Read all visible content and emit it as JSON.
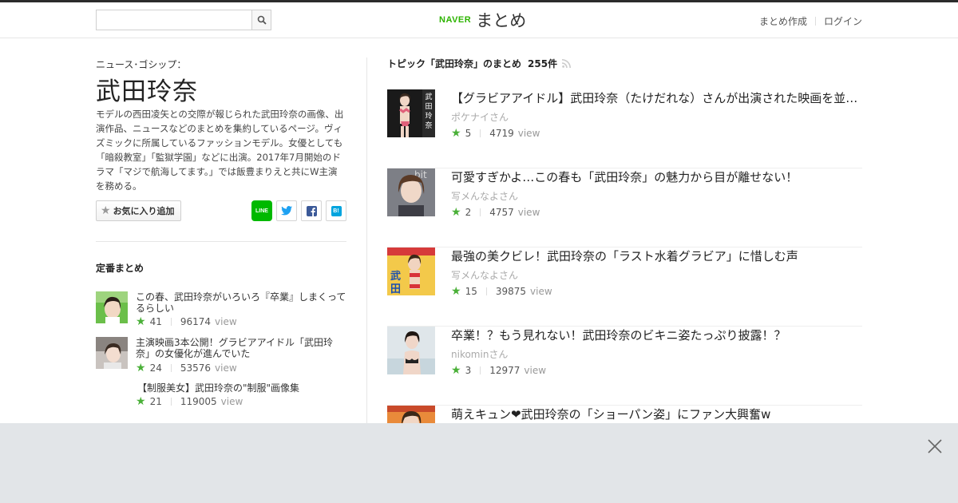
{
  "header": {
    "search": {
      "placeholder": "",
      "value": ""
    },
    "logo": {
      "brand": "NAVER",
      "name": "まとめ"
    },
    "links": [
      {
        "label": "まとめ作成"
      },
      {
        "label": "ログイン"
      }
    ]
  },
  "topic": {
    "category": "ニュース･ゴシップ：",
    "title": "武田玲奈",
    "description": "モデルの西田凌矢との交際が報じられた武田玲奈の画像、出演作品、ニュースなどのまとめを集約しているページ。ヴィズミックに所属しているファッションモデル。女優としても「暗殺教室」「監獄学園」などに出演。2017年7月開始のドラマ「マジで航海してます。」では飯豊まりえと共にW主演を務める。",
    "favorite_label": "お気に入り追加",
    "share": {
      "line": "LINE",
      "twitter": "twitter-icon",
      "facebook": "facebook-icon",
      "hatena": "B!"
    }
  },
  "teiban": {
    "title": "定番まとめ",
    "items": [
      {
        "title": "この春、武田玲奈がいろいろ『卒業』しまくってるらしい",
        "likes": "41",
        "views": "96174",
        "view_label": "view",
        "has_thumb": true
      },
      {
        "title": "主演映画3本公開！グラビアアイドル「武田玲奈」の女優化が進んでいた",
        "likes": "24",
        "views": "53576",
        "view_label": "view",
        "has_thumb": true
      },
      {
        "title": "【制服美女】武田玲奈の\"制服\"画像集",
        "likes": "21",
        "views": "119005",
        "view_label": "view",
        "has_thumb": false
      }
    ]
  },
  "topic_list": {
    "heading": "トピック「武田玲奈」のまとめ",
    "count": "255件",
    "items": [
      {
        "title": "【グラビアアイドル】武田玲奈（たけだれな）さんが出演された映画を並べてみました",
        "author": "ポケナイさん",
        "likes": "5",
        "views": "4719",
        "view_label": "view"
      },
      {
        "title": "可愛すぎかよ…この春も「武田玲奈」の魅力から目が離せない！",
        "author": "写メんなよさん",
        "likes": "2",
        "views": "4757",
        "view_label": "view"
      },
      {
        "title": "最強の美クビレ！武田玲奈の「ラスト水着グラビア」に惜しむ声",
        "author": "写メんなよさん",
        "likes": "15",
        "views": "39875",
        "view_label": "view"
      },
      {
        "title": "卒業！？もう見れない！武田玲奈のビキニ姿たっぷり披露！？",
        "author": "nikominさん",
        "likes": "3",
        "views": "12977",
        "view_label": "view"
      },
      {
        "title": "萌えキュン❤武田玲奈の「ショーパン姿」にファン大興奮w",
        "author": "",
        "likes": "",
        "views": "",
        "view_label": ""
      }
    ]
  },
  "colors": {
    "accent": "#2db400",
    "star": "#4ab038",
    "overlay": "#e2e5e8"
  }
}
